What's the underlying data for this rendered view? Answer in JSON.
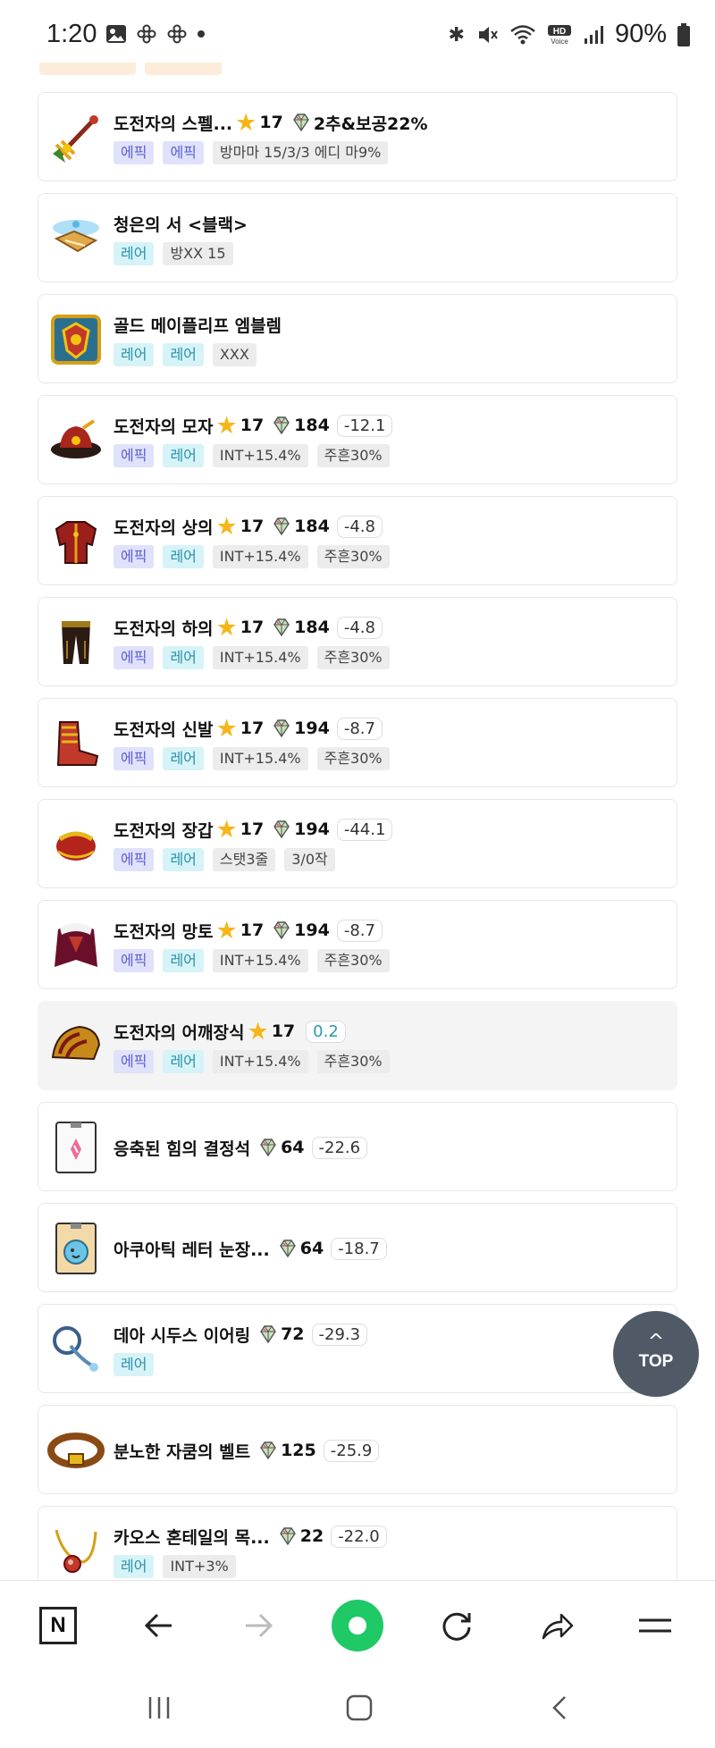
{
  "status_bar": {
    "time": "1:20",
    "battery": "90%",
    "left_icons": [
      "gallery-icon",
      "flower-icon",
      "flower-icon",
      "dot-icon"
    ],
    "right_icons": [
      "bluetooth-icon",
      "mute-icon",
      "wifi-icon",
      "hd-voice-icon",
      "signal-icon",
      "battery-icon"
    ]
  },
  "items": [
    {
      "name": "도전자의 스펠...",
      "stars": "17",
      "gem_value": "2추&보공22%",
      "diff": null,
      "diff_type": null,
      "tags": [
        {
          "text": "에픽",
          "kind": "epic"
        },
        {
          "text": "에픽",
          "kind": "epic"
        },
        {
          "text": "방마마 15/3/3 에디 마9%",
          "kind": "opt"
        }
      ],
      "icon": "spell-weapon-icon",
      "active": false
    },
    {
      "name": "청은의 서 <블랙>",
      "stars": null,
      "gem_value": null,
      "diff": null,
      "diff_type": null,
      "tags": [
        {
          "text": "레어",
          "kind": "rare"
        },
        {
          "text": "방XX 15",
          "kind": "opt"
        }
      ],
      "icon": "book-icon",
      "active": false
    },
    {
      "name": "골드 메이플리프 엠블렘",
      "stars": null,
      "gem_value": null,
      "diff": null,
      "diff_type": null,
      "tags": [
        {
          "text": "레어",
          "kind": "rare"
        },
        {
          "text": "레어",
          "kind": "rare"
        },
        {
          "text": "XXX",
          "kind": "opt"
        }
      ],
      "icon": "emblem-icon",
      "active": false
    },
    {
      "name": "도전자의 모자",
      "stars": "17",
      "gem_value": "184",
      "diff": "-12.1",
      "diff_type": "neg",
      "tags": [
        {
          "text": "에픽",
          "kind": "epic"
        },
        {
          "text": "레어",
          "kind": "rare"
        },
        {
          "text": "INT+15.4%",
          "kind": "opt"
        },
        {
          "text": "주흔30%",
          "kind": "opt"
        }
      ],
      "icon": "hat-icon",
      "active": false
    },
    {
      "name": "도전자의 상의",
      "stars": "17",
      "gem_value": "184",
      "diff": "-4.8",
      "diff_type": "neg",
      "tags": [
        {
          "text": "에픽",
          "kind": "epic"
        },
        {
          "text": "레어",
          "kind": "rare"
        },
        {
          "text": "INT+15.4%",
          "kind": "opt"
        },
        {
          "text": "주흔30%",
          "kind": "opt"
        }
      ],
      "icon": "top-armor-icon",
      "active": false
    },
    {
      "name": "도전자의 하의",
      "stars": "17",
      "gem_value": "184",
      "diff": "-4.8",
      "diff_type": "neg",
      "tags": [
        {
          "text": "에픽",
          "kind": "epic"
        },
        {
          "text": "레어",
          "kind": "rare"
        },
        {
          "text": "INT+15.4%",
          "kind": "opt"
        },
        {
          "text": "주흔30%",
          "kind": "opt"
        }
      ],
      "icon": "pants-icon",
      "active": false
    },
    {
      "name": "도전자의 신발",
      "stars": "17",
      "gem_value": "194",
      "diff": "-8.7",
      "diff_type": "neg",
      "tags": [
        {
          "text": "에픽",
          "kind": "epic"
        },
        {
          "text": "레어",
          "kind": "rare"
        },
        {
          "text": "INT+15.4%",
          "kind": "opt"
        },
        {
          "text": "주흔30%",
          "kind": "opt"
        }
      ],
      "icon": "shoes-icon",
      "active": false
    },
    {
      "name": "도전자의 장갑",
      "stars": "17",
      "gem_value": "194",
      "diff": "-44.1",
      "diff_type": "neg",
      "tags": [
        {
          "text": "에픽",
          "kind": "epic"
        },
        {
          "text": "레어",
          "kind": "rare"
        },
        {
          "text": "스탯3줄",
          "kind": "opt"
        },
        {
          "text": "3/0작",
          "kind": "opt"
        }
      ],
      "icon": "gloves-icon",
      "active": false
    },
    {
      "name": "도전자의 망토",
      "stars": "17",
      "gem_value": "194",
      "diff": "-8.7",
      "diff_type": "neg",
      "tags": [
        {
          "text": "에픽",
          "kind": "epic"
        },
        {
          "text": "레어",
          "kind": "rare"
        },
        {
          "text": "INT+15.4%",
          "kind": "opt"
        },
        {
          "text": "주흔30%",
          "kind": "opt"
        }
      ],
      "icon": "cape-icon",
      "active": false
    },
    {
      "name": "도전자의 어깨장식",
      "stars": "17",
      "gem_value": null,
      "diff": "0.2",
      "diff_type": "pos",
      "tags": [
        {
          "text": "에픽",
          "kind": "epic"
        },
        {
          "text": "레어",
          "kind": "rare"
        },
        {
          "text": "INT+15.4%",
          "kind": "opt"
        },
        {
          "text": "주흔30%",
          "kind": "opt"
        }
      ],
      "icon": "shoulder-icon",
      "active": true
    },
    {
      "name": "응축된 힘의 결정석",
      "stars": null,
      "gem_value": "64",
      "diff": "-22.6",
      "diff_type": "neg",
      "tags": [],
      "icon": "crystal-card-icon",
      "active": false
    },
    {
      "name": "아쿠아틱 레터 눈장...",
      "stars": null,
      "gem_value": "64",
      "diff": "-18.7",
      "diff_type": "neg",
      "tags": [],
      "icon": "aquatic-card-icon",
      "active": false
    },
    {
      "name": "데아 시두스 이어링",
      "stars": null,
      "gem_value": "72",
      "diff": "-29.3",
      "diff_type": "neg",
      "tags": [
        {
          "text": "레어",
          "kind": "rare"
        }
      ],
      "icon": "earring-icon",
      "active": false
    },
    {
      "name": "분노한 자쿰의 벨트",
      "stars": null,
      "gem_value": "125",
      "diff": "-25.9",
      "diff_type": "neg",
      "tags": [],
      "icon": "belt-icon",
      "active": false
    },
    {
      "name": "카오스 혼테일의 목...",
      "stars": null,
      "gem_value": "22",
      "diff": "-22.0",
      "diff_type": "neg",
      "tags": [
        {
          "text": "레어",
          "kind": "rare"
        },
        {
          "text": "INT+3%",
          "kind": "opt"
        }
      ],
      "icon": "necklace-icon",
      "active": false
    }
  ],
  "top_button": {
    "label": "TOP",
    "icon": "chevron-up-icon"
  },
  "browser_bar": {
    "naver_label": "N",
    "buttons": [
      "naver-home-icon",
      "back-arrow-icon",
      "forward-arrow-icon",
      "green-dot-icon",
      "refresh-icon",
      "share-icon",
      "menu-icon"
    ]
  },
  "system_nav": {
    "buttons": [
      "recent-apps-icon",
      "home-icon",
      "back-icon"
    ]
  },
  "colors": {
    "epic_bg": "#e0e2fb",
    "rare_bg": "#d6f3f8",
    "star": "#f6b619",
    "green": "#1ec966",
    "top_button": "#505a66"
  }
}
